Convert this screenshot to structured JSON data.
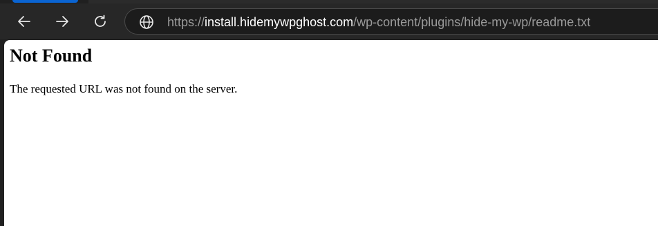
{
  "browser": {
    "accent_color": "#0a64d2",
    "toolbar": {
      "back_icon": "arrow-left-icon",
      "forward_icon": "arrow-right-icon",
      "reload_icon": "reload-icon"
    },
    "address_bar": {
      "site_info_icon": "globe-icon",
      "url_scheme": "https://",
      "url_host": "install.hidemywpghost.com",
      "url_path": "/wp-content/plugins/hide-my-wp/readme.txt"
    }
  },
  "page": {
    "title": "Not Found",
    "message": "The requested URL was not found on the server."
  }
}
